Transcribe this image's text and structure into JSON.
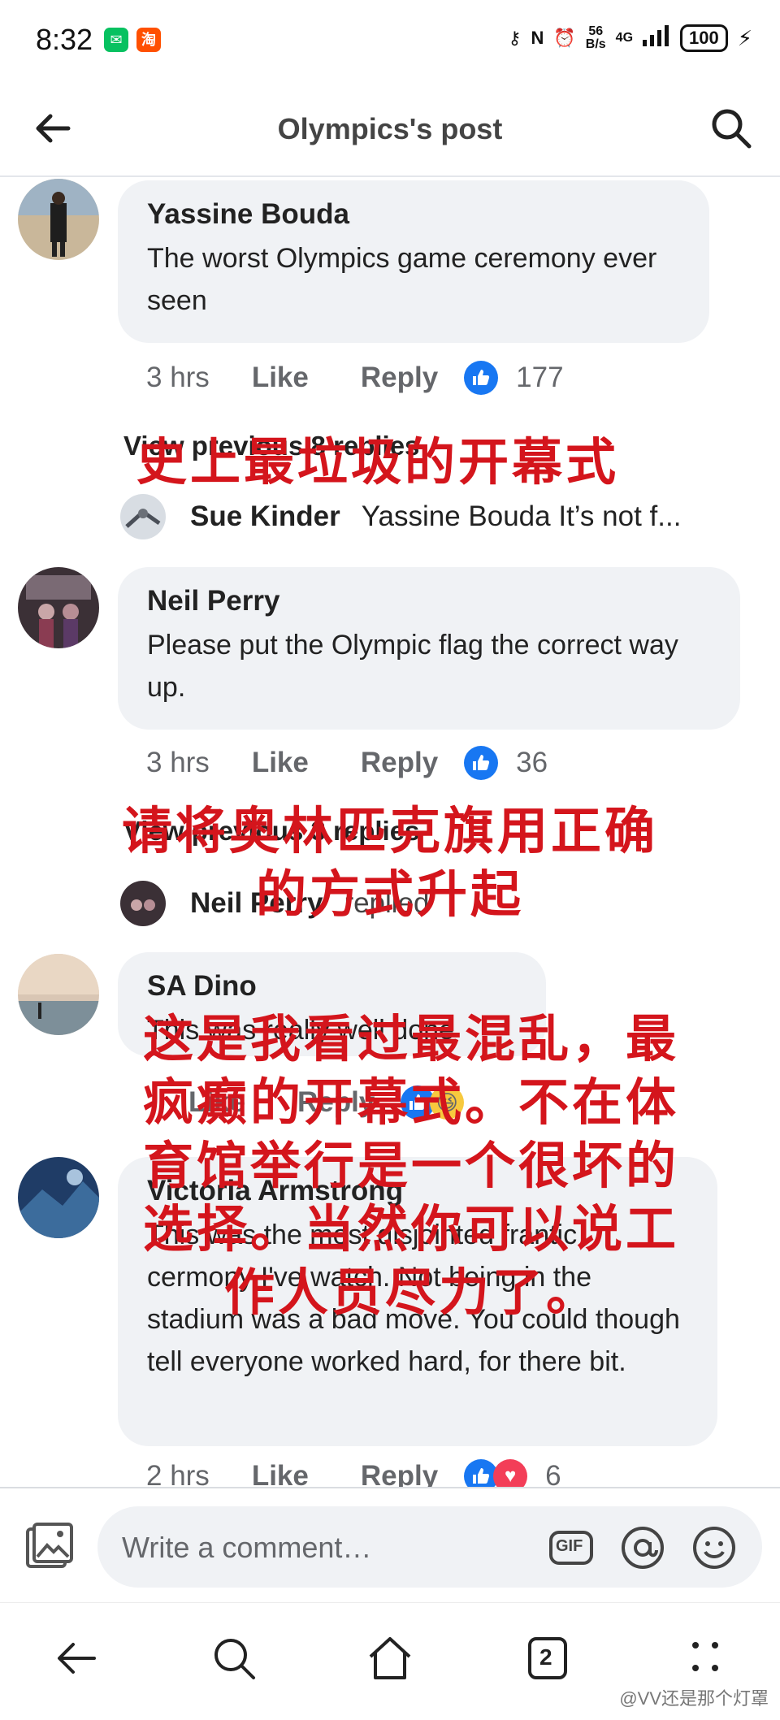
{
  "status_bar": {
    "time": "8:32",
    "net_speed_value": "56",
    "net_speed_unit": "B/s",
    "network": "4G",
    "battery": "100"
  },
  "header": {
    "title": "Olympics's post"
  },
  "comments": [
    {
      "author": "Yassine Bouda",
      "text": "The worst Olympics game ceremony ever seen",
      "time": "3 hrs",
      "like_label": "Like",
      "reply_label": "Reply",
      "reactions": "177"
    },
    {
      "author": "Neil Perry",
      "text": "Please put the Olympic flag the correct way up.",
      "time": "3 hrs",
      "like_label": "Like",
      "reply_label": "Reply",
      "reactions": "36"
    },
    {
      "author": "SA Dino",
      "text": "This was really well done",
      "time": "",
      "like_label": "Like",
      "reply_label": "Reply",
      "reactions": ""
    },
    {
      "author": "Victoria Armstrong",
      "text": "This was the most disjointed frantic cermony I've watch. Not being in the stadium was a bad move. You could though tell everyone worked hard, for there bit.",
      "time": "2 hrs",
      "like_label": "Like",
      "reply_label": "Reply",
      "reactions": "6"
    }
  ],
  "threads": {
    "first_link": "View previous 8 replies",
    "first_reply_name": "Sue Kinder",
    "first_reply_text": "Yassine Bouda It’s not f...",
    "second_link": "View previous 3 replies",
    "second_reply_name": "Neil Perry",
    "second_reply_text": "replied"
  },
  "overlays": {
    "o1": "史上最垃圾的开幕式",
    "o2_line1": "请将奥林匹克旗用正确",
    "o2_line2": "的方式升起",
    "o3_line1": "这是我看过最混乱，最",
    "o3_line2": "疯癫的开幕式。不在体",
    "o3_line3": "育馆举行是一个很坏的",
    "o3_line4": "选择。当然你可以说工",
    "o3_line5": "作人员尽力了。"
  },
  "composer": {
    "placeholder": "Write a comment…",
    "gif_label": "GIF"
  },
  "navbar": {
    "tabs_count": "2",
    "watermark": "@VV还是那个灯罩"
  },
  "colors": {
    "facebook_blue": "#1877f2",
    "overlay_red": "#d4151c",
    "bubble_bg": "#f0f2f5"
  }
}
